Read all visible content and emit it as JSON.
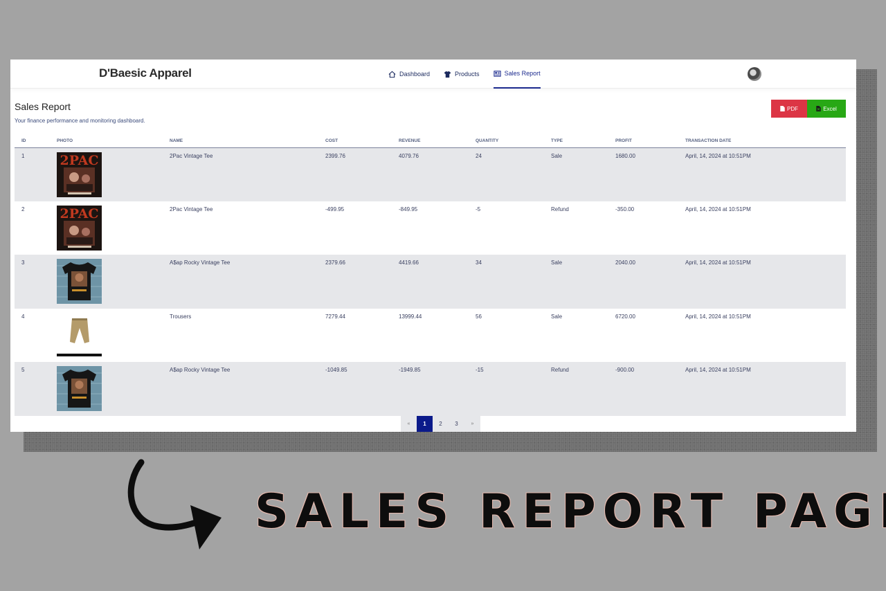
{
  "app": {
    "brand": "D'Baesic Apparel"
  },
  "nav": {
    "items": [
      {
        "label": "Dashboard",
        "icon": "home-icon"
      },
      {
        "label": "Products",
        "icon": "tshirt-icon"
      },
      {
        "label": "Sales Report",
        "icon": "newspaper-icon",
        "active": true
      }
    ]
  },
  "page": {
    "title": "Sales Report",
    "subtitle": "Your finance performance and monitoring dashboard."
  },
  "export": {
    "pdf_label": "PDF",
    "excel_label": "Excel",
    "pdf_color": "#dc3545",
    "excel_color": "#28a815"
  },
  "table": {
    "columns": [
      "ID",
      "PHOTO",
      "NAME",
      "COST",
      "REVENUE",
      "QUANTITY",
      "TYPE",
      "PROFIT",
      "TRANSACTION DATE"
    ],
    "rows": [
      {
        "id": "1",
        "photo": "2pac-tee-photo",
        "name": "2Pac Vintage Tee",
        "cost": "2399.76",
        "revenue": "4079.76",
        "quantity": "24",
        "type": "Sale",
        "profit": "1680.00",
        "date": "April, 14, 2024 at 10:51PM"
      },
      {
        "id": "2",
        "photo": "2pac-tee-photo",
        "name": "2Pac Vintage Tee",
        "cost": "-499.95",
        "revenue": "-849.95",
        "quantity": "-5",
        "type": "Refund",
        "profit": "-350.00",
        "date": "April, 14, 2024 at 10:51PM"
      },
      {
        "id": "3",
        "photo": "asap-tee-photo",
        "name": "A$ap Rocky Vintage Tee",
        "cost": "2379.66",
        "revenue": "4419.66",
        "quantity": "34",
        "type": "Sale",
        "profit": "2040.00",
        "date": "April, 14, 2024 at 10:51PM"
      },
      {
        "id": "4",
        "photo": "trousers-photo",
        "name": "Trousers",
        "cost": "7279.44",
        "revenue": "13999.44",
        "quantity": "56",
        "type": "Sale",
        "profit": "6720.00",
        "date": "April, 14, 2024 at 10:51PM"
      },
      {
        "id": "5",
        "photo": "asap-tee-photo",
        "name": "A$ap Rocky Vintage Tee",
        "cost": "-1049.85",
        "revenue": "-1949.85",
        "quantity": "-15",
        "type": "Refund",
        "profit": "-900.00",
        "date": "April, 14, 2024 at 10:51PM"
      }
    ]
  },
  "pagination": {
    "prev": "«",
    "pages": [
      "1",
      "2",
      "3"
    ],
    "next": "»",
    "current": "1"
  },
  "caption": "SALES REPORT PAGE"
}
